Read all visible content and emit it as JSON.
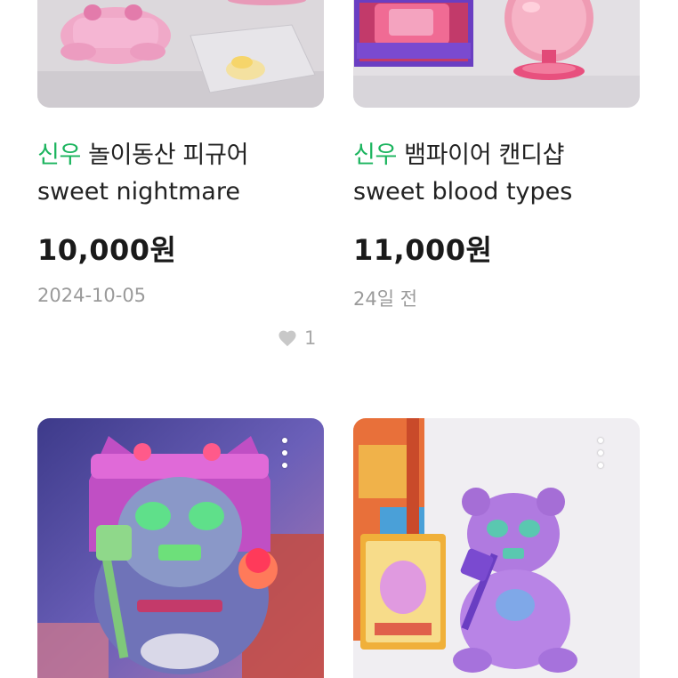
{
  "products": [
    {
      "brand": "신우",
      "title": "놀이동산 피규어",
      "subtitle": "sweet nightmare",
      "price": "10,000원",
      "date": "2024-10-05",
      "likes": "1"
    },
    {
      "brand": "신우",
      "title": "뱀파이어 캔디샵",
      "subtitle": "sweet blood types",
      "price": "11,000원",
      "date": "24일 전"
    }
  ],
  "colors": {
    "brand": "#1bb45e",
    "price": "#1a1a1a",
    "meta": "#9a9a9a"
  },
  "icons": {
    "like": "heart-icon",
    "more": "kebab-menu-icon"
  }
}
